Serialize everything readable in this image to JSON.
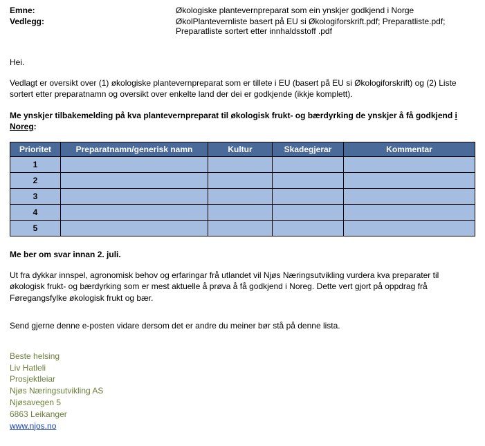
{
  "header": {
    "emne_label": "Emne:",
    "emne_value": "Økologiske plantevernpreparat som ein ynskjer godkjend i Norge",
    "vedlegg_label": "Vedlegg:",
    "vedlegg_value1": "ØkolPlantevernliste basert på EU si Økologiforskrift.pdf; Preparatliste.pdf;",
    "vedlegg_value2": "Preparatliste sortert etter innhaldsstoff .pdf"
  },
  "body": {
    "greeting": "Hei.",
    "para1": "Vedlagt er oversikt over (1) økologiske plantevernpreparat som er tillete i EU (basert på EU si Økologiforskrift) og (2) Liste sortert etter preparatnamn og oversikt over enkelte land der dei er godkjende (ikkje komplett).",
    "lead_in1": "Me ynskjer tilbakemelding på kva plantevernpreparat til økologisk frukt- og bærdyrking de ynskjer å få godkjend ",
    "lead_in_underline": "i Noreg",
    "lead_in_colon": ":",
    "deadline": "Me ber om svar innan 2. juli.",
    "para2": "Ut fra dykkar innspel, agronomisk behov og erfaringar frå utlandet vil Njøs Næringsutvikling vurdera kva preparater til økologisk frukt- og bærdyrking som er mest aktuelle å prøva å få godkjend i Noreg. Dette vert gjort på oppdrag frå Føregangsfylke økologisk frukt og bær.",
    "para3": "Send gjerne denne e-posten vidare dersom det er andre du meiner bør stå på denne lista."
  },
  "table": {
    "headers": {
      "prioritet": "Prioritet",
      "preparat": "Preparatnamn/generisk namn",
      "kultur": "Kultur",
      "skadegjerar": "Skadegjerar",
      "kommentar": "Kommentar"
    },
    "rows": [
      "1",
      "2",
      "3",
      "4",
      "5"
    ]
  },
  "signature": {
    "greeting": "Beste helsing",
    "name": "Liv Hatleli",
    "title": "Prosjektleiar",
    "company": "Njøs Næringsutvikling AS",
    "street": "Njøsavegen 5",
    "city": "6863 Leikanger",
    "url": "www.njos.no"
  }
}
